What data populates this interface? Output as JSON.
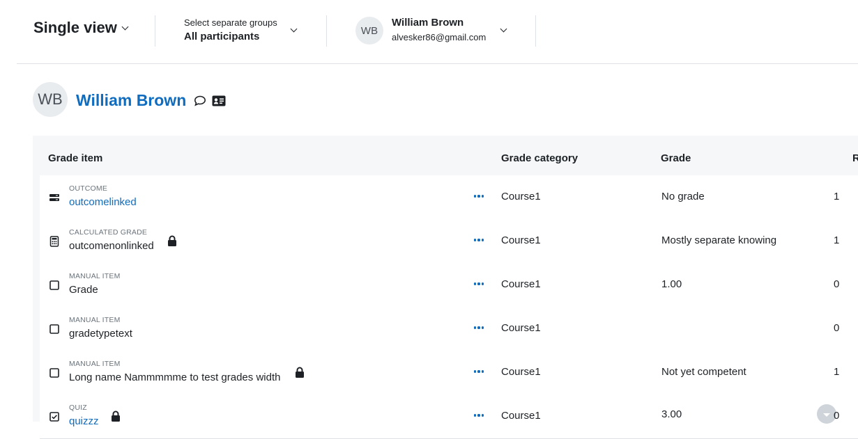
{
  "header": {
    "view_title": "Single view",
    "group_label": "Select separate groups",
    "group_value": "All participants",
    "user_initials": "WB",
    "user_name": "William Brown",
    "user_email": "alvesker86@gmail.com"
  },
  "profile": {
    "initials": "WB",
    "name": "William Brown",
    "message_icon": "speech-bubble-icon",
    "profile_icon": "id-card-icon"
  },
  "table": {
    "columns": [
      "Grade item",
      "Grade category",
      "Grade",
      "R"
    ],
    "rows": [
      {
        "icon": "outcome-icon",
        "type": "OUTCOME",
        "name": "outcomelinked",
        "link": true,
        "locked": false,
        "category": "Course1",
        "grade": "No grade",
        "range": "1"
      },
      {
        "icon": "calculator-icon",
        "type": "CALCULATED GRADE",
        "name": "outcomenonlinked",
        "link": false,
        "locked": true,
        "category": "Course1",
        "grade": "Mostly separate knowing",
        "range": "1"
      },
      {
        "icon": "checkbox-icon",
        "type": "MANUAL ITEM",
        "name": "Grade",
        "link": false,
        "locked": false,
        "category": "Course1",
        "grade": "1.00",
        "range": "0"
      },
      {
        "icon": "checkbox-icon",
        "type": "MANUAL ITEM",
        "name": "gradetypetext",
        "link": false,
        "locked": false,
        "category": "Course1",
        "grade": "",
        "range": "0"
      },
      {
        "icon": "checkbox-icon",
        "type": "MANUAL ITEM",
        "name": "Long name Nammmmme to test grades width",
        "link": false,
        "locked": true,
        "category": "Course1",
        "grade": "Not yet competent",
        "range": "1"
      },
      {
        "icon": "quiz-icon",
        "type": "QUIZ",
        "name": "quizzz",
        "link": true,
        "locked": true,
        "category": "Course1",
        "grade": "3.00",
        "range": "0"
      }
    ]
  },
  "colors": {
    "link": "#0f6cbf",
    "text": "#1d2125",
    "muted": "#6a737b",
    "header_bg": "#f5f7f9"
  }
}
